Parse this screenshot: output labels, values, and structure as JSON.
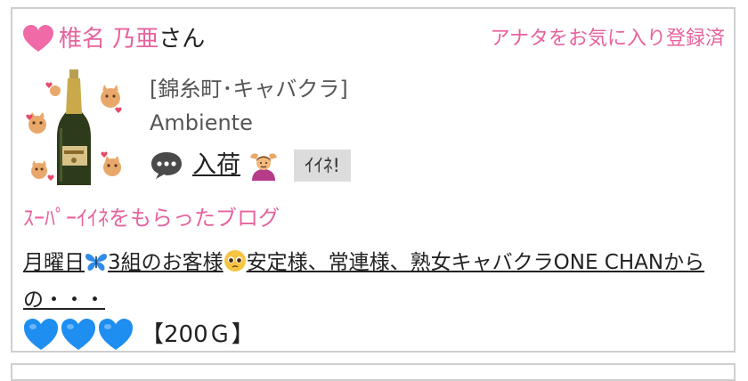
{
  "header": {
    "name": "椎名 乃亜",
    "honorific": "さん",
    "favorite_status": "アナタをお気に入り登録済"
  },
  "profile": {
    "category": "[錦糸町･キャバクラ]",
    "shop": "Ambiente",
    "status_text": "入荷",
    "iine_label": "ｲｲﾈ!"
  },
  "blog": {
    "section_title": "ｽｰﾊﾟｰｲｲﾈをもらったブログ",
    "text_part1": "月曜日",
    "text_part2": "3組のお客様",
    "text_part3": "安定様、常連様、熟女キャバクラONE CHANからの・・・"
  },
  "reward": {
    "hearts": 3,
    "points": "【200Ｇ】"
  },
  "colors": {
    "accent_pink": "#e8629e",
    "heart_blue": "#1e8ef0",
    "button_gray": "#dcdcdc",
    "border_gray": "#cfcfcf"
  },
  "icons": [
    "pink-heart-icon",
    "speech-bubble-icon",
    "person-gesturing-ok-icon",
    "butterfly-icon",
    "pleading-face-icon",
    "blue-heart-icon"
  ]
}
